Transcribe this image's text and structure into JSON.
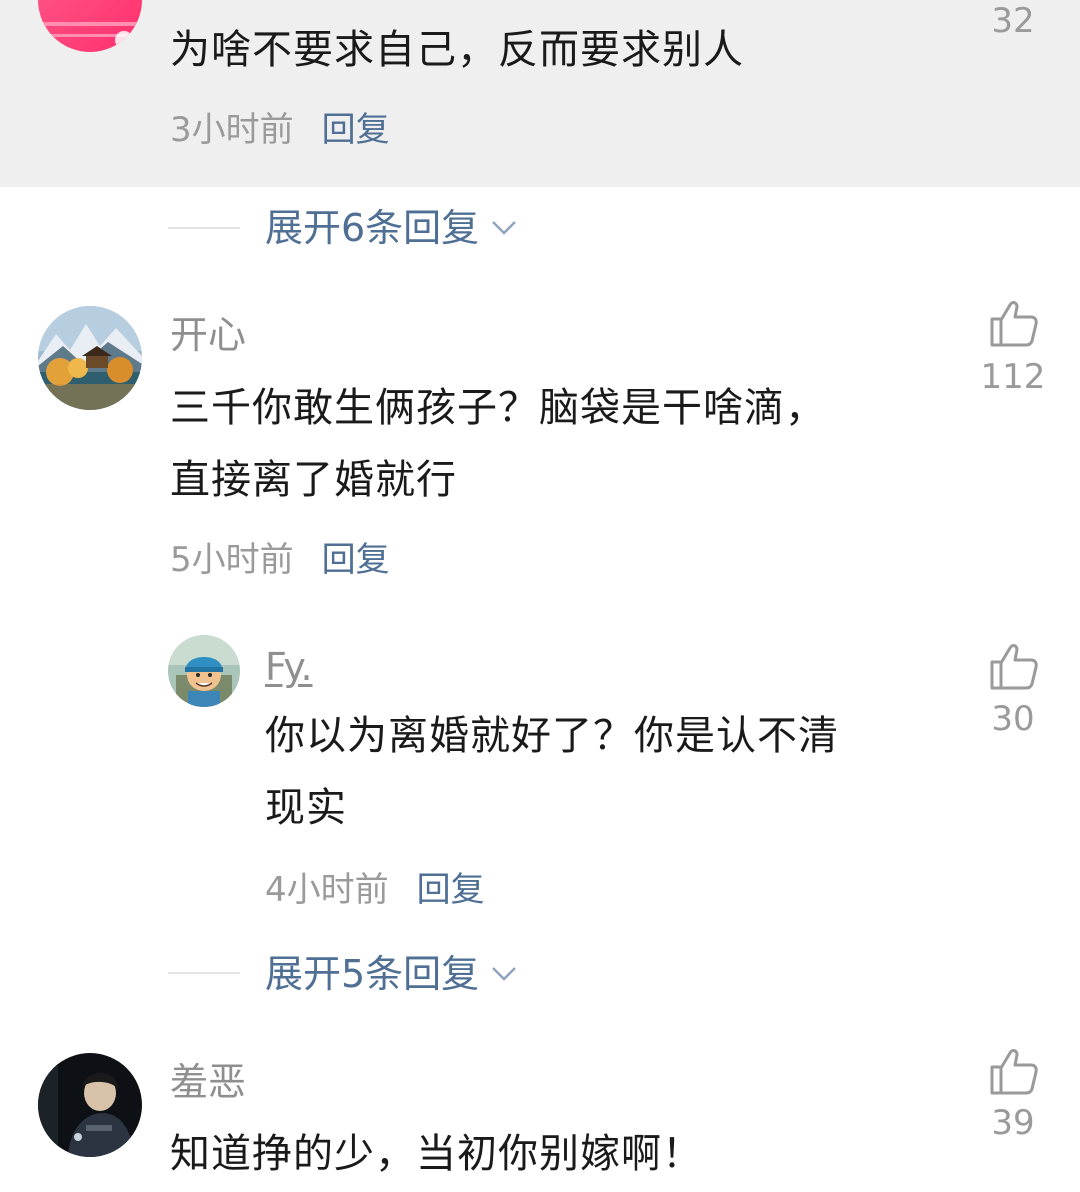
{
  "comments": [
    {
      "username": "",
      "content_lines": [
        "为啥不要求自己，反而要求别人"
      ],
      "time": "3小时前",
      "reply_label": "回复",
      "likes": "32",
      "avatar_icon": "pink-avatar-icon",
      "expand_label": "展开6条回复"
    },
    {
      "username": "开心",
      "content_lines": [
        "三千你敢生俩孩子？脑袋是干啥滴，",
        "直接离了婚就行"
      ],
      "time": "5小时前",
      "reply_label": "回复",
      "likes": "112",
      "avatar_icon": "landscape-avatar-icon"
    },
    {
      "username": "Fy.",
      "content_lines": [
        "你以为离婚就好了？你是认不清",
        "现实"
      ],
      "time": "4小时前",
      "reply_label": "回复",
      "likes": "30",
      "avatar_icon": "cartoon-avatar-icon",
      "expand_label": "展开5条回复"
    },
    {
      "username": "羞恶",
      "content_lines": [
        "知道挣的少，当初你别嫁啊！"
      ],
      "likes": "39",
      "avatar_icon": "dark-photo-avatar-icon"
    }
  ],
  "colors": {
    "highlight_bg": "#efefef",
    "link_blue": "#4f6f94",
    "meta_gray": "#9a9a9a"
  }
}
